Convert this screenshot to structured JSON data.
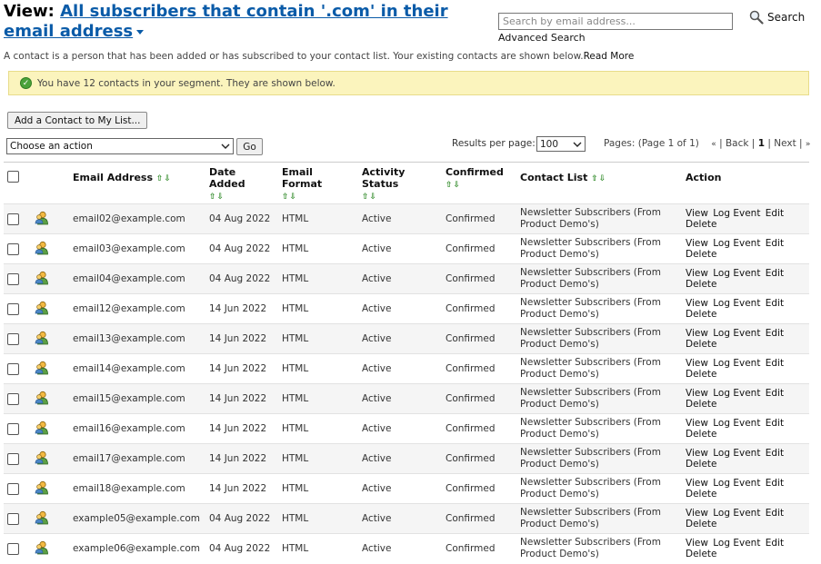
{
  "header": {
    "view_prefix": "View:",
    "segment_link": "All subscribers that contain '.com' in their email address"
  },
  "search": {
    "placeholder": "Search by email address...",
    "advanced_label": "Advanced Search",
    "button_label": "Search"
  },
  "intro": {
    "text": "A contact is a person that has been added or has subscribed to your contact list. Your existing contacts are shown below.",
    "read_more": "Read More"
  },
  "notice": {
    "text": "You have 12 contacts in your segment. They are shown below."
  },
  "toolbar": {
    "add_contact": "Add a Contact to My List...",
    "action_select": "Choose an action",
    "go": "Go",
    "results_label": "Results per page:",
    "results_value": "100"
  },
  "pager": {
    "pages_text": "Pages: (Page 1 of 1)",
    "first": "«",
    "back": "Back",
    "current": "1",
    "next": "Next",
    "last": "»"
  },
  "table": {
    "columns": {
      "email": "Email Address",
      "date": "Date Added",
      "format": "Email Format",
      "activity": "Activity Status",
      "confirmed": "Confirmed",
      "list": "Contact List",
      "action": "Action"
    },
    "sort_arrows": "⇧⇩",
    "action_labels": {
      "view": "View",
      "log": "Log Event",
      "edit": "Edit",
      "delete": "Delete"
    },
    "rows": [
      {
        "email": "email02@example.com",
        "date": "04 Aug 2022",
        "format": "HTML",
        "status": "Active",
        "confirmed": "Confirmed",
        "list": "Newsletter Subscribers (From Product Demo's)"
      },
      {
        "email": "email03@example.com",
        "date": "04 Aug 2022",
        "format": "HTML",
        "status": "Active",
        "confirmed": "Confirmed",
        "list": "Newsletter Subscribers (From Product Demo's)"
      },
      {
        "email": "email04@example.com",
        "date": "04 Aug 2022",
        "format": "HTML",
        "status": "Active",
        "confirmed": "Confirmed",
        "list": "Newsletter Subscribers (From Product Demo's)"
      },
      {
        "email": "email12@example.com",
        "date": "14 Jun 2022",
        "format": "HTML",
        "status": "Active",
        "confirmed": "Confirmed",
        "list": "Newsletter Subscribers (From Product Demo's)"
      },
      {
        "email": "email13@example.com",
        "date": "14 Jun 2022",
        "format": "HTML",
        "status": "Active",
        "confirmed": "Confirmed",
        "list": "Newsletter Subscribers (From Product Demo's)"
      },
      {
        "email": "email14@example.com",
        "date": "14 Jun 2022",
        "format": "HTML",
        "status": "Active",
        "confirmed": "Confirmed",
        "list": "Newsletter Subscribers (From Product Demo's)"
      },
      {
        "email": "email15@example.com",
        "date": "14 Jun 2022",
        "format": "HTML",
        "status": "Active",
        "confirmed": "Confirmed",
        "list": "Newsletter Subscribers (From Product Demo's)"
      },
      {
        "email": "email16@example.com",
        "date": "14 Jun 2022",
        "format": "HTML",
        "status": "Active",
        "confirmed": "Confirmed",
        "list": "Newsletter Subscribers (From Product Demo's)"
      },
      {
        "email": "email17@example.com",
        "date": "14 Jun 2022",
        "format": "HTML",
        "status": "Active",
        "confirmed": "Confirmed",
        "list": "Newsletter Subscribers (From Product Demo's)"
      },
      {
        "email": "email18@example.com",
        "date": "14 Jun 2022",
        "format": "HTML",
        "status": "Active",
        "confirmed": "Confirmed",
        "list": "Newsletter Subscribers (From Product Demo's)"
      },
      {
        "email": "example05@example.com",
        "date": "04 Aug 2022",
        "format": "HTML",
        "status": "Active",
        "confirmed": "Confirmed",
        "list": "Newsletter Subscribers (From Product Demo's)"
      },
      {
        "email": "example06@example.com",
        "date": "04 Aug 2022",
        "format": "HTML",
        "status": "Active",
        "confirmed": "Confirmed",
        "list": "Newsletter Subscribers (From Product Demo's)"
      }
    ]
  },
  "icons": {
    "search": "magnifier-icon",
    "success": "check-circle-icon",
    "contact": "user-icon",
    "sort": "sort-arrows-icon",
    "dropdown": "chevron-down-icon"
  },
  "colors": {
    "link": "#0a5ba8",
    "notice_bg": "#fbf4bd",
    "sort_arrow": "#2f8a27",
    "success": "#4aa23a"
  }
}
